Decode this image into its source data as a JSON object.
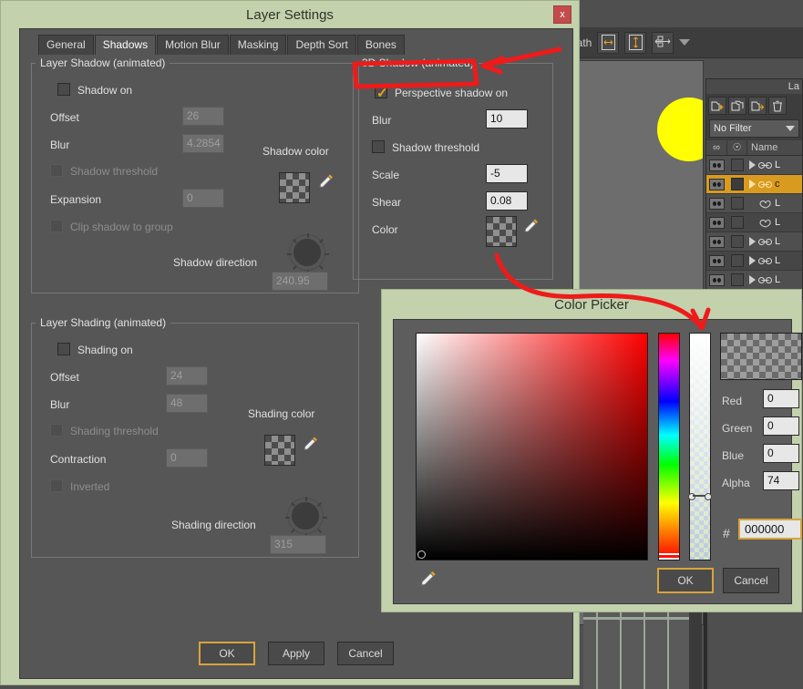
{
  "background_app": {
    "toolbar": {
      "path_label": "path",
      "buttons": [
        "width-icon",
        "height-icon",
        "transform-icon"
      ],
      "dropdown_caret": "chevron-down-icon"
    },
    "layers_panel": {
      "title": "La",
      "tool_buttons": [
        "add-layer-icon",
        "duplicate-layer-icon",
        "move-layer-icon",
        "delete-layer-icon"
      ],
      "filter": {
        "value": "No Filter",
        "caret": "chevron-down-icon"
      },
      "columns": [
        "visibility",
        "lock",
        "Name"
      ],
      "rows": [
        {
          "name": "L",
          "type": "bone",
          "expandable": true,
          "selected": false
        },
        {
          "name": "c",
          "type": "bone",
          "expandable": true,
          "selected": true
        },
        {
          "name": "L",
          "type": "vector",
          "expandable": false,
          "selected": false
        },
        {
          "name": "L",
          "type": "vector",
          "expandable": false,
          "selected": false
        },
        {
          "name": "L",
          "type": "bone",
          "expandable": true,
          "selected": false
        },
        {
          "name": "L",
          "type": "bone",
          "expandable": true,
          "selected": false
        },
        {
          "name": "L",
          "type": "bone",
          "expandable": true,
          "selected": false
        }
      ]
    }
  },
  "layer_settings": {
    "title": "Layer Settings",
    "close_label": "x",
    "tabs": [
      {
        "label": "General",
        "active": false
      },
      {
        "label": "Shadows",
        "active": true
      },
      {
        "label": "Motion Blur",
        "active": false
      },
      {
        "label": "Masking",
        "active": false
      },
      {
        "label": "Depth Sort",
        "active": false
      },
      {
        "label": "Bones",
        "active": false
      }
    ],
    "layer_shadow": {
      "legend": "Layer Shadow (animated)",
      "shadow_on": {
        "label": "Shadow on",
        "checked": false
      },
      "offset": {
        "label": "Offset",
        "value": "26"
      },
      "blur": {
        "label": "Blur",
        "value": "4.2854"
      },
      "shadow_threshold": {
        "label": "Shadow threshold",
        "checked": false
      },
      "expansion": {
        "label": "Expansion",
        "value": "0"
      },
      "clip_to_group": {
        "label": "Clip shadow to group",
        "checked": false
      },
      "color_label": "Shadow color",
      "direction_label": "Shadow direction",
      "direction_value": "240.95"
    },
    "layer_shading": {
      "legend": "Layer Shading (animated)",
      "shading_on": {
        "label": "Shading on",
        "checked": false
      },
      "offset": {
        "label": "Offset",
        "value": "24"
      },
      "blur": {
        "label": "Blur",
        "value": "48"
      },
      "shading_threshold": {
        "label": "Shading threshold",
        "checked": false
      },
      "contraction": {
        "label": "Contraction",
        "value": "0"
      },
      "inverted": {
        "label": "Inverted",
        "checked": false
      },
      "color_label": "Shading color",
      "direction_label": "Shading direction",
      "direction_value": "315"
    },
    "shadow_3d": {
      "legend": "3D Shadow (animated)",
      "perspective_on": {
        "label": "Perspective shadow on",
        "checked": true
      },
      "blur": {
        "label": "Blur",
        "value": "10"
      },
      "shadow_threshold": {
        "label": "Shadow threshold",
        "checked": false
      },
      "scale": {
        "label": "Scale",
        "value": "-5"
      },
      "shear": {
        "label": "Shear",
        "value": "0.08"
      },
      "color_label": "Color"
    },
    "buttons": {
      "ok": "OK",
      "apply": "Apply",
      "cancel": "Cancel"
    }
  },
  "color_picker": {
    "title": "Color Picker",
    "channels": [
      {
        "label": "Red",
        "value": "0"
      },
      {
        "label": "Green",
        "value": "0"
      },
      {
        "label": "Blue",
        "value": "0"
      },
      {
        "label": "Alpha",
        "value": "74"
      }
    ],
    "hex": {
      "symbol": "#",
      "value": "000000"
    },
    "eyedropper": "eyedropper-icon",
    "buttons": {
      "ok": "OK",
      "cancel": "Cancel"
    }
  },
  "colors": {
    "dialog_titlebar": "#c3d1ad",
    "dialog_body": "#565656",
    "accent_orange": "#d8a43a",
    "selected_row": "#d89b20",
    "annotation_red": "#ee1b1b",
    "close_button": "#c24b4b",
    "canvas_blob": "#ffff00"
  }
}
